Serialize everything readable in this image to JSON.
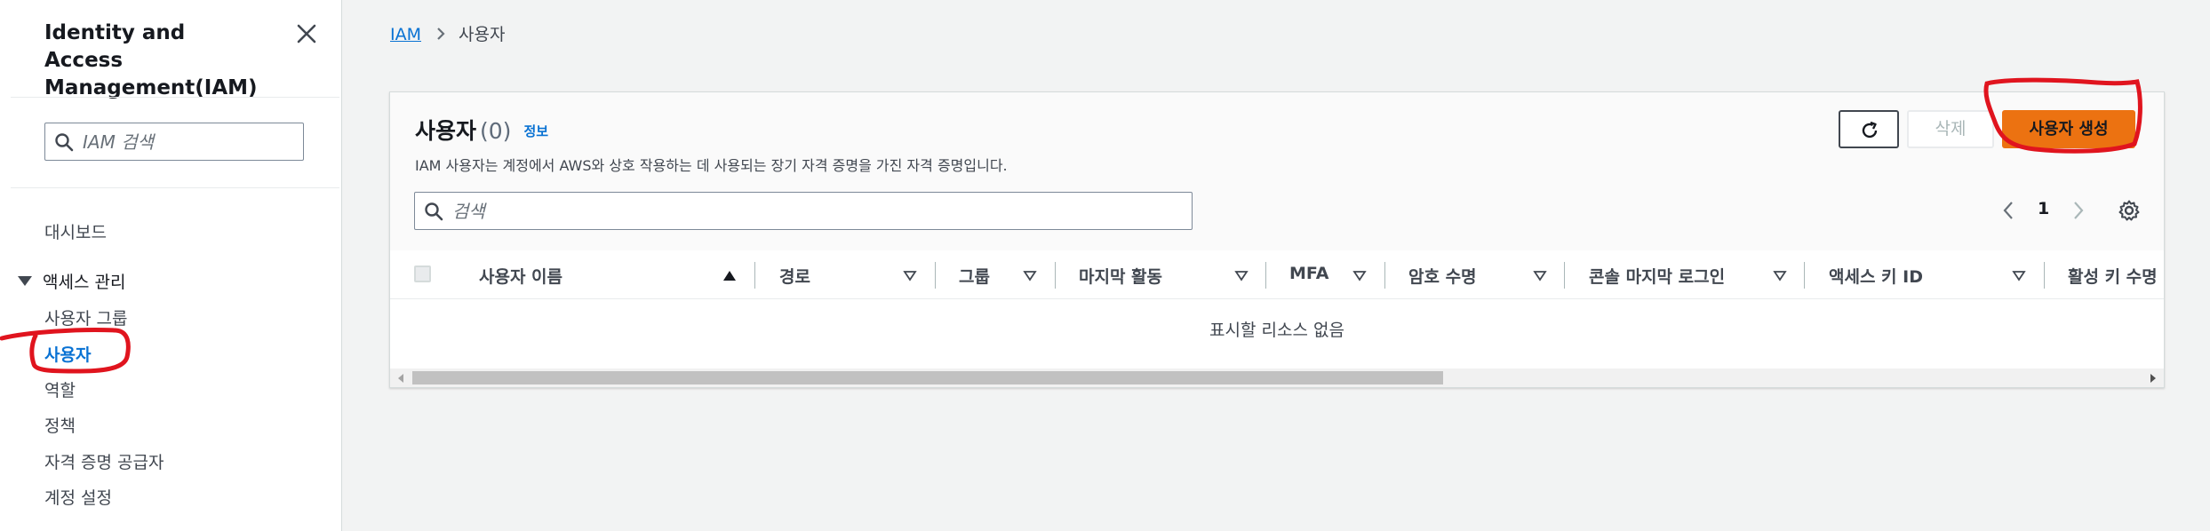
{
  "sidebar": {
    "title": "Identity and Access Management(IAM)",
    "close_icon": "close-icon",
    "search_placeholder": "IAM 검색",
    "dashboard": "대시보드",
    "section_label": "액세스 관리",
    "items": [
      {
        "label": "사용자 그룹",
        "active": false
      },
      {
        "label": "사용자",
        "active": true
      },
      {
        "label": "역할",
        "active": false
      },
      {
        "label": "정책",
        "active": false
      },
      {
        "label": "자격 증명 공급자",
        "active": false
      },
      {
        "label": "계정 설정",
        "active": false
      }
    ]
  },
  "breadcrumb": {
    "root": "IAM",
    "separator_icon": "chevron-right-icon",
    "current": "사용자"
  },
  "panel": {
    "title": "사용자",
    "count": "(0)",
    "info_link": "정보",
    "description": "IAM 사용자는 계정에서 AWS와 상호 작용하는 데 사용되는 장기 자격 증명을 가진 자격 증명입니다.",
    "refresh_icon": "refresh-icon",
    "delete_label": "삭제",
    "create_label": "사용자 생성",
    "search_placeholder": "검색",
    "page_number": "1",
    "settings_icon": "gear-icon"
  },
  "table": {
    "columns": [
      {
        "label": "사용자 이름",
        "sort": "ascending"
      },
      {
        "label": "경로",
        "sort": "none"
      },
      {
        "label": "그룹",
        "sort": "none"
      },
      {
        "label": "마지막 활동",
        "sort": "none"
      },
      {
        "label": "MFA",
        "sort": "none"
      },
      {
        "label": "암호 수명",
        "sort": "none"
      },
      {
        "label": "콘솔 마지막 로그인",
        "sort": "none"
      },
      {
        "label": "액세스 키 ID",
        "sort": "none"
      },
      {
        "label": "활성 키 수명",
        "sort": "none"
      }
    ],
    "rows": [],
    "empty_message": "표시할 리소스 없음"
  },
  "colors": {
    "accent_link": "#0972d3",
    "primary_button": "#ec7211",
    "annotation": "#e0141e"
  }
}
